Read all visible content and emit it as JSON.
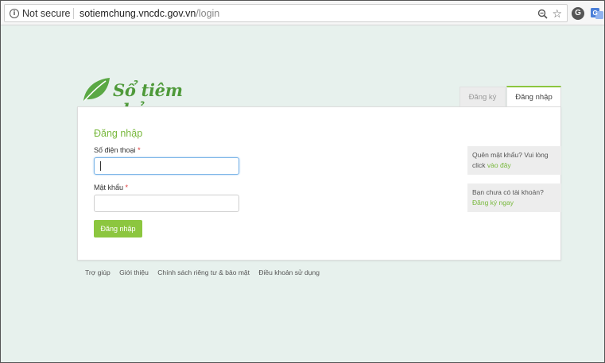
{
  "browser": {
    "security_text": "Not secure",
    "url_host": "sotiemchung.vncdc.gov.vn",
    "url_path": "/login",
    "ext_g_label": "G"
  },
  "logo": {
    "text": "Sổ tiêm chủng"
  },
  "tabs": {
    "register": "Đăng ký",
    "login": "Đăng nhập"
  },
  "form": {
    "title": "Đăng nhập",
    "phone_label": "Số điện thoại",
    "password_label": "Mật khẩu",
    "required_mark": "*",
    "phone_value": "",
    "password_value": "",
    "submit_label": "Đăng nhập"
  },
  "side": {
    "forgot_text": "Quên mật khẩu? Vui lòng click",
    "forgot_link": "vào đây",
    "noacct_text": "Bạn chưa có tài khoản?",
    "noacct_link": "Đăng ký ngay"
  },
  "footer": {
    "links": [
      "Trợ giúp",
      "Giới thiệu",
      "Chính sách riêng tư & bảo mật",
      "Điều khoản sử dụng"
    ]
  },
  "colors": {
    "accent": "#8cc63f",
    "page_bg": "#e7f1ed"
  }
}
